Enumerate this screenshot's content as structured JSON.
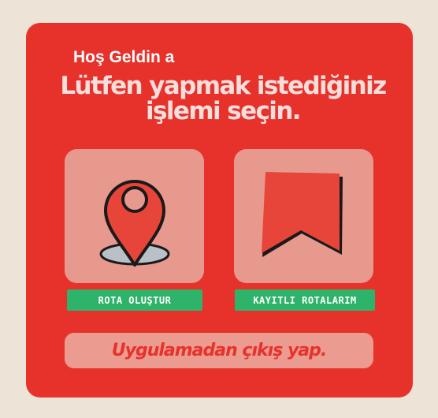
{
  "colors": {
    "background": "#ede3d6",
    "card": "#e7322c",
    "tile": "#e8998d",
    "label_button": "#2eb36a",
    "exit_button": "#ec9b90"
  },
  "header": {
    "welcome": "Hoş Geldin a",
    "subtitle": "Lütfen yapmak istediğiniz işlemi seçin."
  },
  "actions": {
    "create_route": {
      "icon": "map-pin-icon",
      "label": "ROTA OLUŞTUR"
    },
    "saved_routes": {
      "icon": "bookmark-icon",
      "label": "KAYITLI ROTALARIM"
    }
  },
  "exit": {
    "label": "Uygulamadan çıkış yap."
  }
}
